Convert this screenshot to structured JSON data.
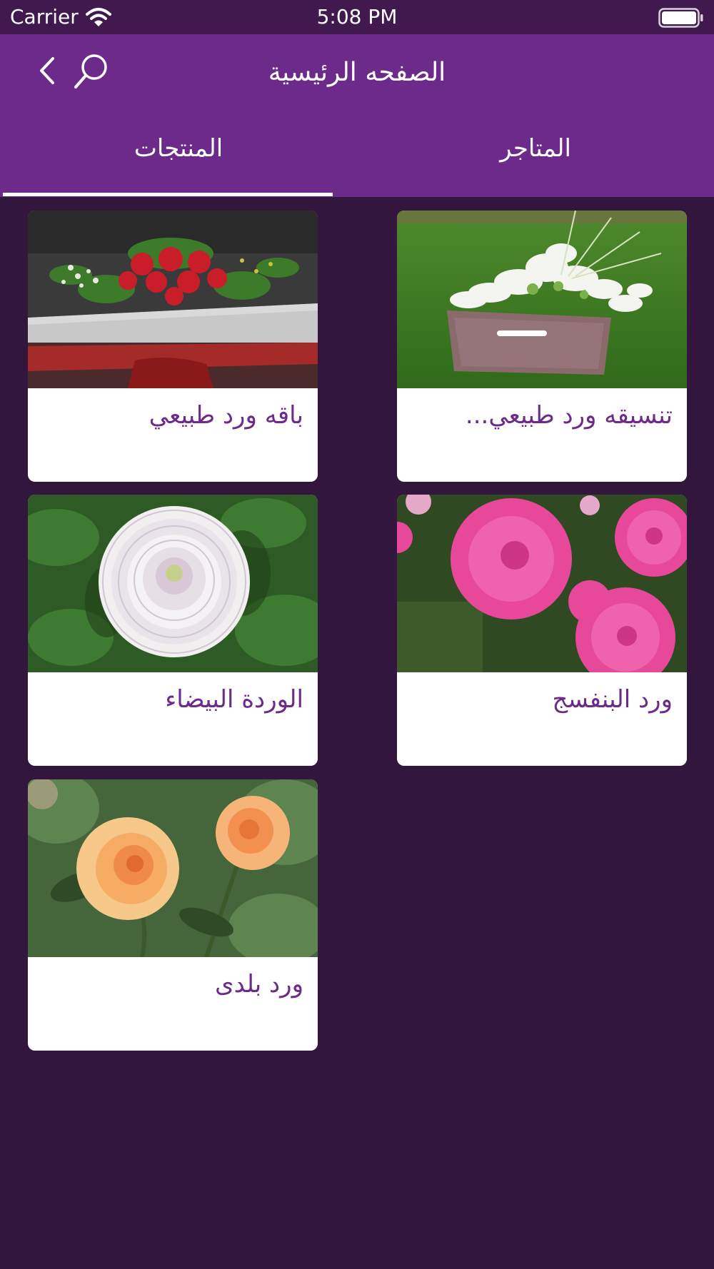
{
  "status_bar": {
    "carrier": "Carrier",
    "time": "5:08 PM"
  },
  "header": {
    "title": "الصفحه الرئيسية"
  },
  "tabs": [
    {
      "label": "المنتجات",
      "selected": true
    },
    {
      "label": "المتاجر",
      "selected": false
    }
  ],
  "products": [
    {
      "title": "تنسيقه ورد طبيعي...",
      "image": "white-flower-arrangement-on-grass"
    },
    {
      "title": "باقه ورد طبيعي",
      "image": "red-rose-bouquet"
    },
    {
      "title": "ورد البنفسج",
      "image": "pink-dahlias"
    },
    {
      "title": "الوردة البيضاء",
      "image": "white-dahlia"
    },
    {
      "title": "ورد بلدى",
      "image": "peach-roses"
    }
  ],
  "colors": {
    "header": "#6c2b8a",
    "status_bar": "#41194e",
    "background": "#33163d",
    "card_title": "#6c2b8a"
  }
}
